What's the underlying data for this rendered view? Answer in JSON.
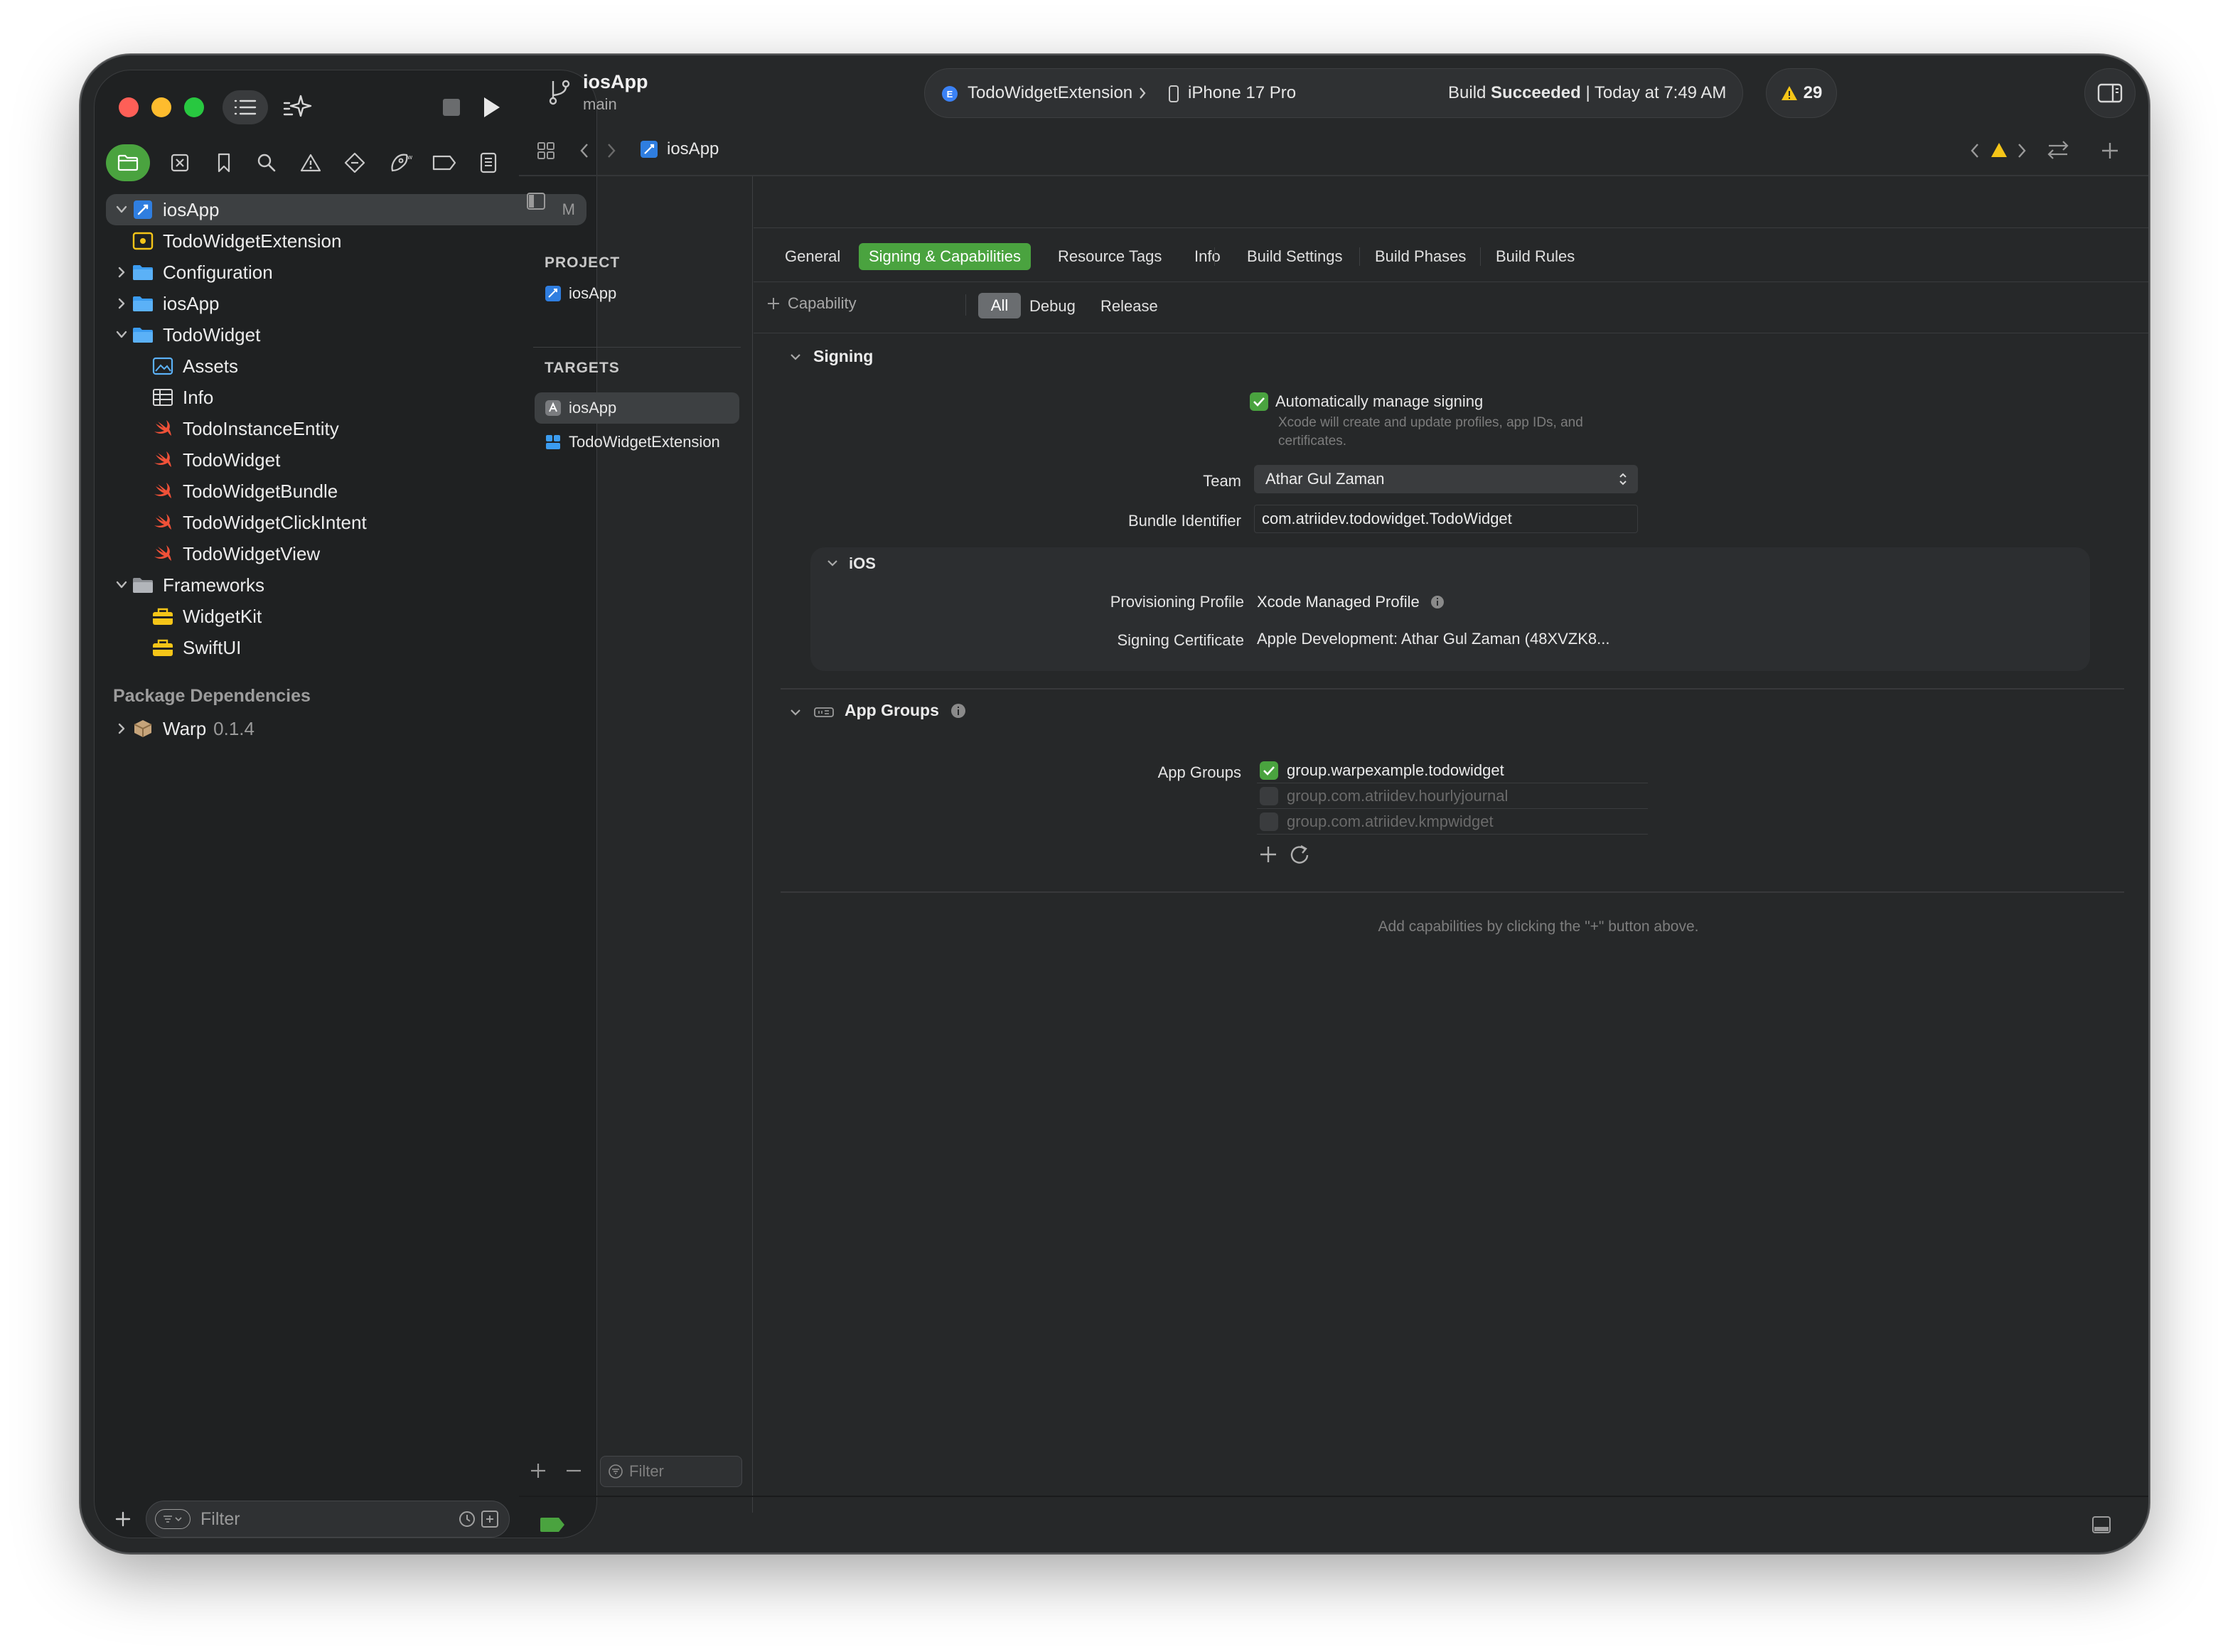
{
  "toolbar": {
    "project_name": "iosApp",
    "branch": "main",
    "scheme": "TodoWidgetExtension",
    "device": "iPhone 17 Pro",
    "build_status_prefix": "Build",
    "build_status_word": "Succeeded",
    "build_status_time": "| Today at 7:49 AM",
    "warnings_count": "29"
  },
  "jump_bar": {
    "item": "iosApp"
  },
  "navigator": {
    "root": {
      "label": "iosApp",
      "badge": "M"
    },
    "items": [
      {
        "label": "TodoWidgetExtension"
      },
      {
        "label": "Configuration"
      },
      {
        "label": "iosApp"
      },
      {
        "label": "TodoWidget"
      },
      {
        "label": "Assets"
      },
      {
        "label": "Info"
      },
      {
        "label": "TodoInstanceEntity"
      },
      {
        "label": "TodoWidget"
      },
      {
        "label": "TodoWidgetBundle"
      },
      {
        "label": "TodoWidgetClickIntent"
      },
      {
        "label": "TodoWidgetView"
      },
      {
        "label": "Frameworks"
      },
      {
        "label": "WidgetKit"
      },
      {
        "label": "SwiftUI"
      }
    ],
    "package_header": "Package Dependencies",
    "package": {
      "name": "Warp",
      "version": "0.1.4"
    },
    "filter_placeholder": "Filter"
  },
  "targets_panel": {
    "project_header": "PROJECT",
    "project_item": "iosApp",
    "targets_header": "TARGETS",
    "targets": [
      {
        "label": "iosApp"
      },
      {
        "label": "TodoWidgetExtension"
      }
    ],
    "filter_placeholder": "Filter"
  },
  "editor_tabs": [
    {
      "label": "General"
    },
    {
      "label": "Signing & Capabilities"
    },
    {
      "label": "Resource Tags"
    },
    {
      "label": "Info"
    },
    {
      "label": "Build Settings"
    },
    {
      "label": "Build Phases"
    },
    {
      "label": "Build Rules"
    }
  ],
  "capability_bar": {
    "add_label": "Capability",
    "segments": [
      "All",
      "Debug",
      "Release"
    ]
  },
  "signing": {
    "title": "Signing",
    "auto_manage_label": "Automatically manage signing",
    "auto_manage_note_1": "Xcode will create and update profiles, app IDs, and",
    "auto_manage_note_2": "certificates.",
    "team_label": "Team",
    "team_value": "Athar Gul Zaman",
    "bundle_label": "Bundle Identifier",
    "bundle_value": "com.atriidev.todowidget.TodoWidget",
    "ios_title": "iOS",
    "prov_label": "Provisioning Profile",
    "prov_value": "Xcode Managed Profile",
    "cert_label": "Signing Certificate",
    "cert_value": "Apple Development: Athar Gul Zaman (48XVZK8..."
  },
  "app_groups": {
    "title": "App Groups",
    "label": "App Groups",
    "groups": [
      {
        "id": "group.warpexample.todowidget",
        "checked": true
      },
      {
        "id": "group.com.atriidev.hourlyjournal",
        "checked": false
      },
      {
        "id": "group.com.atriidev.kmpwidget",
        "checked": false
      }
    ]
  },
  "empty_hint": "Add capabilities by clicking the \"+\" button above.",
  "colors": {
    "accent": "#4aa33f",
    "warning": "#f5c518",
    "swift": "#f05138",
    "folder": "#3b9cf0"
  }
}
